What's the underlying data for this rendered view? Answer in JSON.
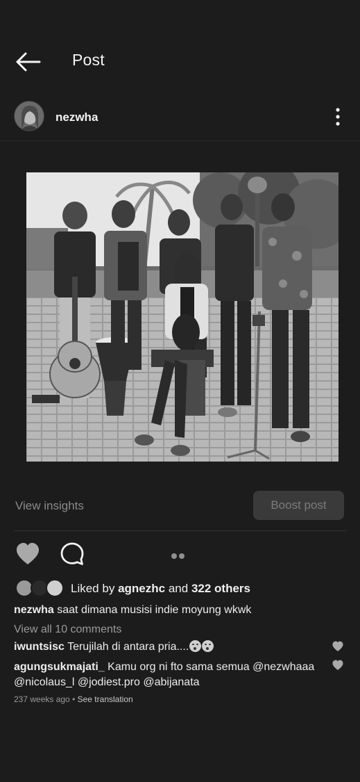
{
  "header": {
    "title": "Post",
    "back_icon": "back-arrow-icon"
  },
  "post": {
    "username": "nezwha",
    "more_icon": "more-vertical-icon",
    "image_description_icon": "group-photo"
  },
  "actions": {
    "view_insights": "View insights",
    "boost_post": "Boost post",
    "like_icon": "heart-icon",
    "comment_icon": "comment-icon"
  },
  "likes": {
    "prefix": "Liked by",
    "user": "agnezhc",
    "conjunction": "and",
    "others": "322 others"
  },
  "caption": {
    "username": "nezwha",
    "text": "saat dimana musisi indie moyung wkwk"
  },
  "view_all_comments": "View all 10 comments",
  "comments": [
    {
      "username": "iwuntsisc",
      "text": "Terujilah di antara pria...."
    },
    {
      "username": "agungsukmajati_",
      "text": "Kamu org ni fto sama semua @nezwhaaa  @nicolaus_l  @jodiest.pro  @abijanata"
    }
  ],
  "meta": {
    "time": "237 weeks ago",
    "separator": "•",
    "see_translation": "See translation"
  },
  "colors": {
    "background": "#1c1c1c",
    "text": "#f2f2f2",
    "muted": "#8a8a8a",
    "button_bg": "#3a3a3a"
  }
}
